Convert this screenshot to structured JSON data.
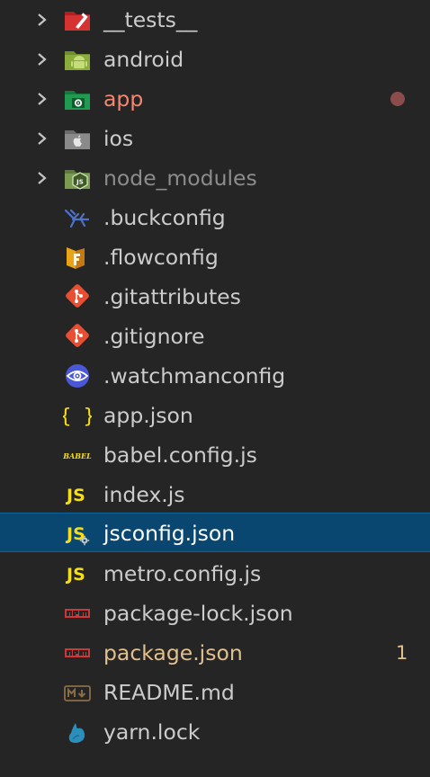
{
  "explorer": {
    "items": [
      {
        "label": "__tests__",
        "kind": "folder",
        "icon": "test-folder-icon"
      },
      {
        "label": "android",
        "kind": "folder",
        "icon": "android-folder-icon"
      },
      {
        "label": "app",
        "kind": "folder",
        "icon": "app-folder-icon",
        "status": "modified",
        "status_color": "#8c4c4c"
      },
      {
        "label": "ios",
        "kind": "folder",
        "icon": "apple-folder-icon"
      },
      {
        "label": "node_modules",
        "kind": "folder",
        "icon": "node-folder-icon",
        "status": "ignored"
      },
      {
        "label": ".buckconfig",
        "kind": "file",
        "icon": "buck-icon"
      },
      {
        "label": ".flowconfig",
        "kind": "file",
        "icon": "flow-icon"
      },
      {
        "label": ".gitattributes",
        "kind": "file",
        "icon": "git-icon"
      },
      {
        "label": ".gitignore",
        "kind": "file",
        "icon": "git-icon"
      },
      {
        "label": ".watchmanconfig",
        "kind": "file",
        "icon": "watchman-icon"
      },
      {
        "label": "app.json",
        "kind": "file",
        "icon": "json-braces-icon"
      },
      {
        "label": "babel.config.js",
        "kind": "file",
        "icon": "babel-icon"
      },
      {
        "label": "index.js",
        "kind": "file",
        "icon": "js-icon"
      },
      {
        "label": "jsconfig.json",
        "kind": "file",
        "icon": "jsconfig-icon",
        "selected": true
      },
      {
        "label": "metro.config.js",
        "kind": "file",
        "icon": "js-icon"
      },
      {
        "label": "package-lock.json",
        "kind": "file",
        "icon": "npm-icon"
      },
      {
        "label": "package.json",
        "kind": "file",
        "icon": "npm-icon",
        "badge": "1",
        "status": "modified"
      },
      {
        "label": "README.md",
        "kind": "file",
        "icon": "markdown-icon"
      },
      {
        "label": "yarn.lock",
        "kind": "file",
        "icon": "yarn-icon"
      }
    ],
    "colors": {
      "background": "#252526",
      "selection": "#094771",
      "text": "#cccccc",
      "modified_red": "#f48771",
      "modified_yellow": "#e2c08d",
      "ignored": "#8c8c8c",
      "js_yellow": "#f5de19"
    }
  }
}
